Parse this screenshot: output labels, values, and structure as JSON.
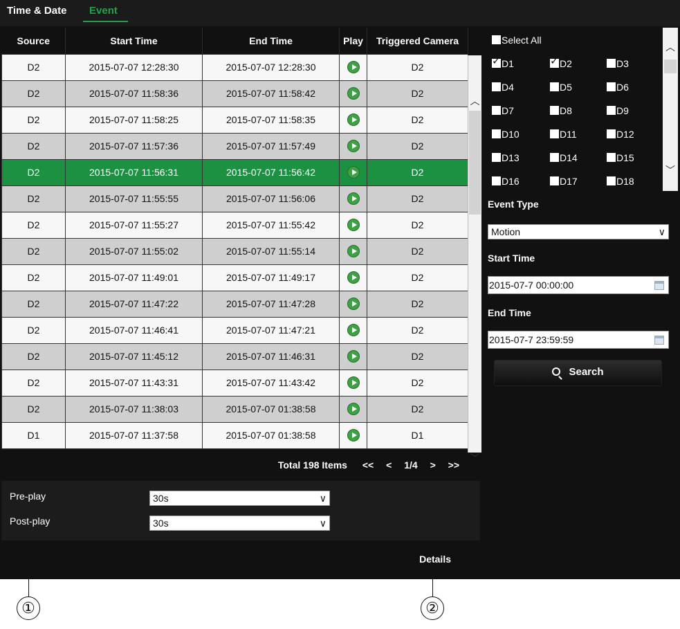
{
  "tabs": [
    {
      "label": "Time & Date"
    },
    {
      "label": "Event"
    }
  ],
  "table": {
    "headers": [
      "Source",
      "Start Time",
      "End Time",
      "Play",
      "Triggered Camera"
    ],
    "rows": [
      {
        "source": "D2",
        "start": "2015-07-07 12:28:30",
        "end": "2015-07-07 12:28:30",
        "camera": "D2"
      },
      {
        "source": "D2",
        "start": "2015-07-07 11:58:36",
        "end": "2015-07-07 11:58:42",
        "camera": "D2"
      },
      {
        "source": "D2",
        "start": "2015-07-07 11:58:25",
        "end": "2015-07-07 11:58:35",
        "camera": "D2"
      },
      {
        "source": "D2",
        "start": "2015-07-07 11:57:36",
        "end": "2015-07-07 11:57:49",
        "camera": "D2"
      },
      {
        "source": "D2",
        "start": "2015-07-07 11:56:31",
        "end": "2015-07-07 11:56:42",
        "camera": "D2"
      },
      {
        "source": "D2",
        "start": "2015-07-07 11:55:55",
        "end": "2015-07-07 11:56:06",
        "camera": "D2"
      },
      {
        "source": "D2",
        "start": "2015-07-07 11:55:27",
        "end": "2015-07-07 11:55:42",
        "camera": "D2"
      },
      {
        "source": "D2",
        "start": "2015-07-07 11:55:02",
        "end": "2015-07-07 11:55:14",
        "camera": "D2"
      },
      {
        "source": "D2",
        "start": "2015-07-07 11:49:01",
        "end": "2015-07-07 11:49:17",
        "camera": "D2"
      },
      {
        "source": "D2",
        "start": "2015-07-07 11:47:22",
        "end": "2015-07-07 11:47:28",
        "camera": "D2"
      },
      {
        "source": "D2",
        "start": "2015-07-07 11:46:41",
        "end": "2015-07-07 11:47:21",
        "camera": "D2"
      },
      {
        "source": "D2",
        "start": "2015-07-07 11:45:12",
        "end": "2015-07-07 11:46:31",
        "camera": "D2"
      },
      {
        "source": "D2",
        "start": "2015-07-07 11:43:31",
        "end": "2015-07-07 11:43:42",
        "camera": "D2"
      },
      {
        "source": "D2",
        "start": "2015-07-07 11:38:03",
        "end": "2015-07-07 01:38:58",
        "camera": "D2"
      },
      {
        "source": "D1",
        "start": "2015-07-07 11:37:58",
        "end": "2015-07-07 01:38:58",
        "camera": "D1"
      }
    ],
    "selected_row": 4
  },
  "pager": {
    "total": "Total 198 Items",
    "first": "<<",
    "prev": "<",
    "page": "1/4",
    "next": ">",
    "last": ">>"
  },
  "options": {
    "preplay_label": "Pre-play",
    "preplay_value": "30s",
    "postplay_label": "Post-play",
    "postplay_value": "30s"
  },
  "details_label": "Details",
  "cameras": {
    "select_all": "Select All",
    "items": [
      {
        "label": "D1",
        "checked": true
      },
      {
        "label": "D2",
        "checked": true
      },
      {
        "label": "D3",
        "checked": false
      },
      {
        "label": "D4",
        "checked": false
      },
      {
        "label": "D5",
        "checked": false
      },
      {
        "label": "D6",
        "checked": false
      },
      {
        "label": "D7",
        "checked": false
      },
      {
        "label": "D8",
        "checked": false
      },
      {
        "label": "D9",
        "checked": false
      },
      {
        "label": "D10",
        "checked": false
      },
      {
        "label": "D11",
        "checked": false
      },
      {
        "label": "D12",
        "checked": false
      },
      {
        "label": "D13",
        "checked": false
      },
      {
        "label": "D14",
        "checked": false
      },
      {
        "label": "D15",
        "checked": false
      },
      {
        "label": "D16",
        "checked": false
      },
      {
        "label": "D17",
        "checked": false
      },
      {
        "label": "D18",
        "checked": false
      }
    ]
  },
  "filters": {
    "event_type_label": "Event Type",
    "event_type_value": "Motion",
    "start_label": "Start Time",
    "start_value": "2015-07-7 00:00:00",
    "end_label": "End Time",
    "end_value": "2015-07-7 23:59:59",
    "search_label": "Search"
  },
  "callouts": [
    "①",
    "②"
  ],
  "colors": {
    "accent": "#1fa34a",
    "selected_row": "#1b9141",
    "panel": "#111111"
  }
}
